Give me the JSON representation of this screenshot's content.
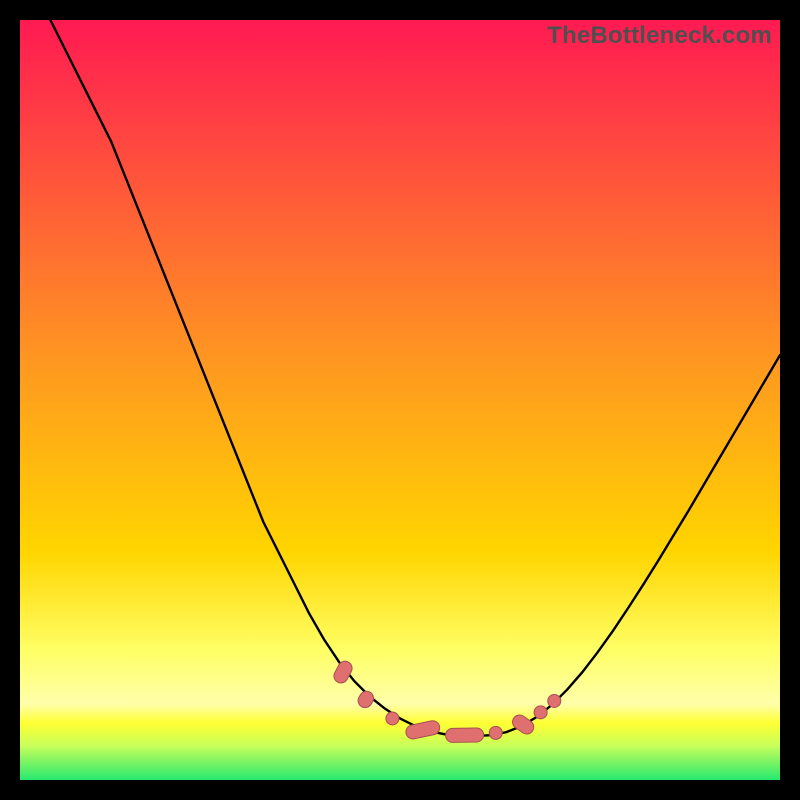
{
  "watermark": "TheBottleneck.com",
  "colors": {
    "frame": "#000000",
    "grad_top": "#ff1a52",
    "grad_mid": "#ffd500",
    "grad_low": "#ffff99",
    "grad_band_yellow": "#ffff55",
    "grad_band_green": "#34f07a",
    "curve": "#000000",
    "knot_fill": "#e07070",
    "knot_stroke": "#a84f4f"
  },
  "chart_data": {
    "type": "line",
    "title": "",
    "xlabel": "",
    "ylabel": "",
    "xlim": [
      0,
      100
    ],
    "ylim": [
      0,
      100
    ],
    "series": [
      {
        "name": "bottleneck-curve",
        "x": [
          4,
          6,
          8,
          10,
          12,
          14,
          16,
          18,
          20,
          22,
          24,
          26,
          28,
          30,
          32,
          34,
          36,
          38,
          40,
          42,
          44,
          46,
          48,
          50,
          52,
          54,
          56,
          58,
          60,
          62,
          64,
          66,
          68,
          70,
          72,
          74,
          76,
          78,
          80,
          82,
          84,
          86,
          88,
          90,
          92,
          94,
          96,
          98,
          100
        ],
        "y": [
          100,
          96,
          92,
          88,
          84,
          79,
          74,
          69,
          64,
          59,
          54,
          49,
          44,
          39,
          34,
          30,
          26,
          22,
          18.5,
          15.5,
          13,
          11,
          9.4,
          8.1,
          7.1,
          6.4,
          6,
          5.8,
          5.8,
          5.9,
          6.3,
          7.1,
          8.3,
          9.9,
          11.9,
          14.2,
          16.8,
          19.6,
          22.6,
          25.7,
          28.9,
          32.2,
          35.5,
          38.9,
          42.3,
          45.7,
          49.1,
          52.5,
          55.9
        ]
      }
    ],
    "knots": [
      {
        "x": 42.5,
        "y": 14.2,
        "shape": "pill",
        "len": 3.0,
        "angle": -62
      },
      {
        "x": 45.5,
        "y": 10.6,
        "shape": "pill",
        "len": 2.2,
        "angle": -58
      },
      {
        "x": 49.0,
        "y": 8.1,
        "shape": "dot"
      },
      {
        "x": 53.0,
        "y": 6.6,
        "shape": "pill",
        "len": 4.5,
        "angle": -12
      },
      {
        "x": 58.5,
        "y": 5.9,
        "shape": "pill",
        "len": 5.0,
        "angle": -1
      },
      {
        "x": 62.6,
        "y": 6.2,
        "shape": "dot"
      },
      {
        "x": 66.2,
        "y": 7.3,
        "shape": "pill",
        "len": 3.0,
        "angle": 35
      },
      {
        "x": 68.5,
        "y": 8.9,
        "shape": "dot"
      },
      {
        "x": 70.3,
        "y": 10.4,
        "shape": "dot"
      }
    ],
    "gradient_stops": [
      {
        "pct": 0,
        "color": "#ff1a52"
      },
      {
        "pct": 46,
        "color": "#ff9a1f"
      },
      {
        "pct": 70,
        "color": "#ffd500"
      },
      {
        "pct": 83,
        "color": "#ffff66"
      },
      {
        "pct": 90,
        "color": "#ffffaa"
      },
      {
        "pct": 92.5,
        "color": "#ffff33"
      },
      {
        "pct": 95.5,
        "color": "#c7ff5a"
      },
      {
        "pct": 100,
        "color": "#28e86f"
      }
    ]
  }
}
